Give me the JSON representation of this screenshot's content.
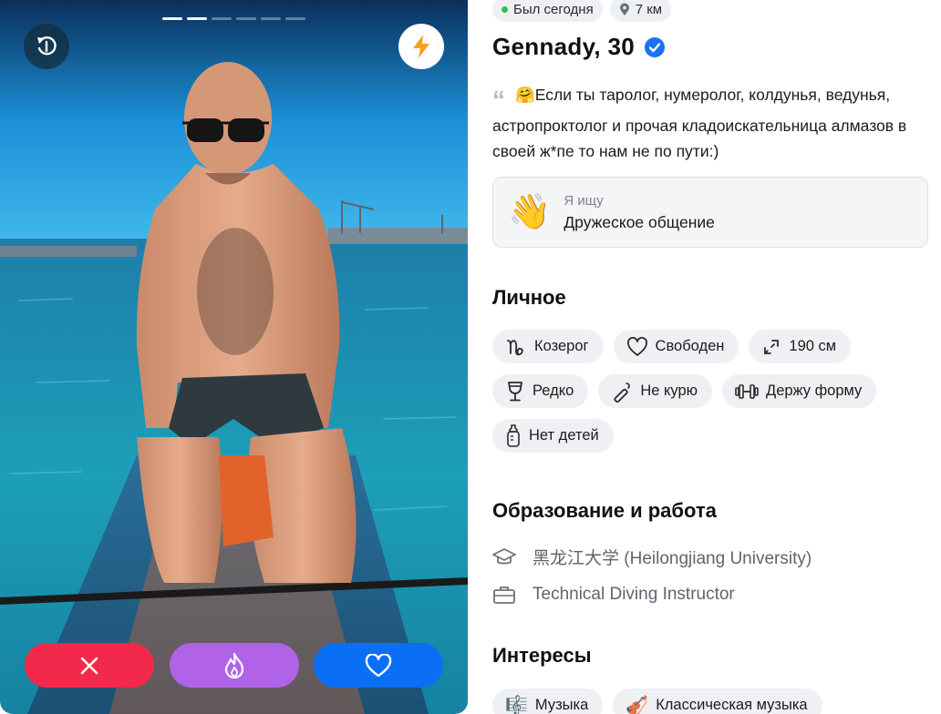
{
  "photo": {
    "photo_count": 6,
    "active_index": 1
  },
  "actions": {
    "undo_icon": "undo-icon",
    "boost_icon": "lightning-icon",
    "dislike_icon": "close-icon",
    "superlike_icon": "flame-icon",
    "like_icon": "heart-icon"
  },
  "colors": {
    "dislike": "#f2294a",
    "superlike": "#b163e8",
    "like": "#0a6ff5",
    "online": "#2dc44d",
    "verified": "#1a73f0"
  },
  "profile": {
    "last_seen": "Был сегодня",
    "distance": "7 км",
    "name_age": "Gennady, 30",
    "verified": true,
    "bio_emoji": "🤗",
    "bio": "Если ты таролог, нумеролог, колдунья, ведунья, астропроктолог и прочая кладоискательница алмазов в своей ж*пе то нам не по пути:)",
    "seeking": {
      "emoji": "👋",
      "label": "Я ищу",
      "value": "Дружеское общение"
    }
  },
  "personal": {
    "title": "Личное",
    "chips": [
      {
        "icon": "capricorn-icon",
        "label": "Козерог"
      },
      {
        "icon": "heart-outline-icon",
        "label": "Свободен"
      },
      {
        "icon": "expand-icon",
        "label": "190 см"
      },
      {
        "icon": "wine-glass-icon",
        "label": "Редко"
      },
      {
        "icon": "no-smoking-icon",
        "label": "Не курю"
      },
      {
        "icon": "dumbbell-icon",
        "label": "Держу форму"
      },
      {
        "icon": "baby-bottle-icon",
        "label": "Нет детей"
      }
    ]
  },
  "education": {
    "title": "Образование и работа",
    "university": "黑龙江大学 (Heilongjiang University)",
    "university_icon": "graduation-cap-icon",
    "job": "Technical Diving Instructor",
    "job_icon": "briefcase-icon"
  },
  "interests": {
    "title": "Интересы",
    "chips": [
      {
        "emoji": "🎼",
        "label": "Музыка"
      },
      {
        "emoji": "🎻",
        "label": "Классическая музыка"
      }
    ]
  }
}
